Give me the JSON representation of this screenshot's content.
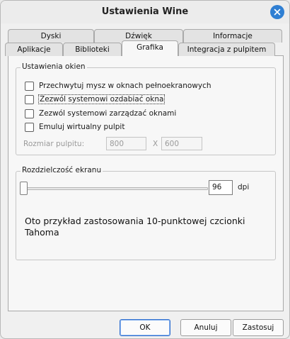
{
  "window": {
    "title": "Ustawienia Wine"
  },
  "tabs_row1": [
    {
      "label": "Dyski"
    },
    {
      "label": "Dźwięk"
    },
    {
      "label": "Informacje"
    }
  ],
  "tabs_row2": [
    {
      "label": "Aplikacje"
    },
    {
      "label": "Biblioteki"
    },
    {
      "label": "Grafika",
      "active": true
    },
    {
      "label": "Integracja z pulpitem"
    }
  ],
  "window_settings": {
    "title": "Ustawienia okien",
    "options": [
      {
        "label": "Przechwytuj mysz w oknach pełnoekranowych",
        "checked": false
      },
      {
        "label": "Zezwól systemowi ozdabiać okna",
        "checked": false,
        "focused": true
      },
      {
        "label": "Zezwól systemowi zarządzać oknami",
        "checked": false
      },
      {
        "label": "Emuluj wirtualny pulpit",
        "checked": false
      }
    ],
    "desktop_size_label": "Rozmiar pulpitu:",
    "width_value": "800",
    "separator": "X",
    "height_value": "600"
  },
  "resolution": {
    "title": "Rozdzielczość ekranu",
    "dpi_value": "96",
    "dpi_unit": "dpi",
    "slider_fraction": 0.0,
    "sample_text": "Oto przykład zastosowania 10-punktowej czcionki Tahoma"
  },
  "buttons": {
    "ok": "OK",
    "cancel": "Anuluj",
    "apply": "Zastosuj"
  },
  "colors": {
    "close_button": "#2f7fd3",
    "default_button_border": "#2f6fd0"
  }
}
